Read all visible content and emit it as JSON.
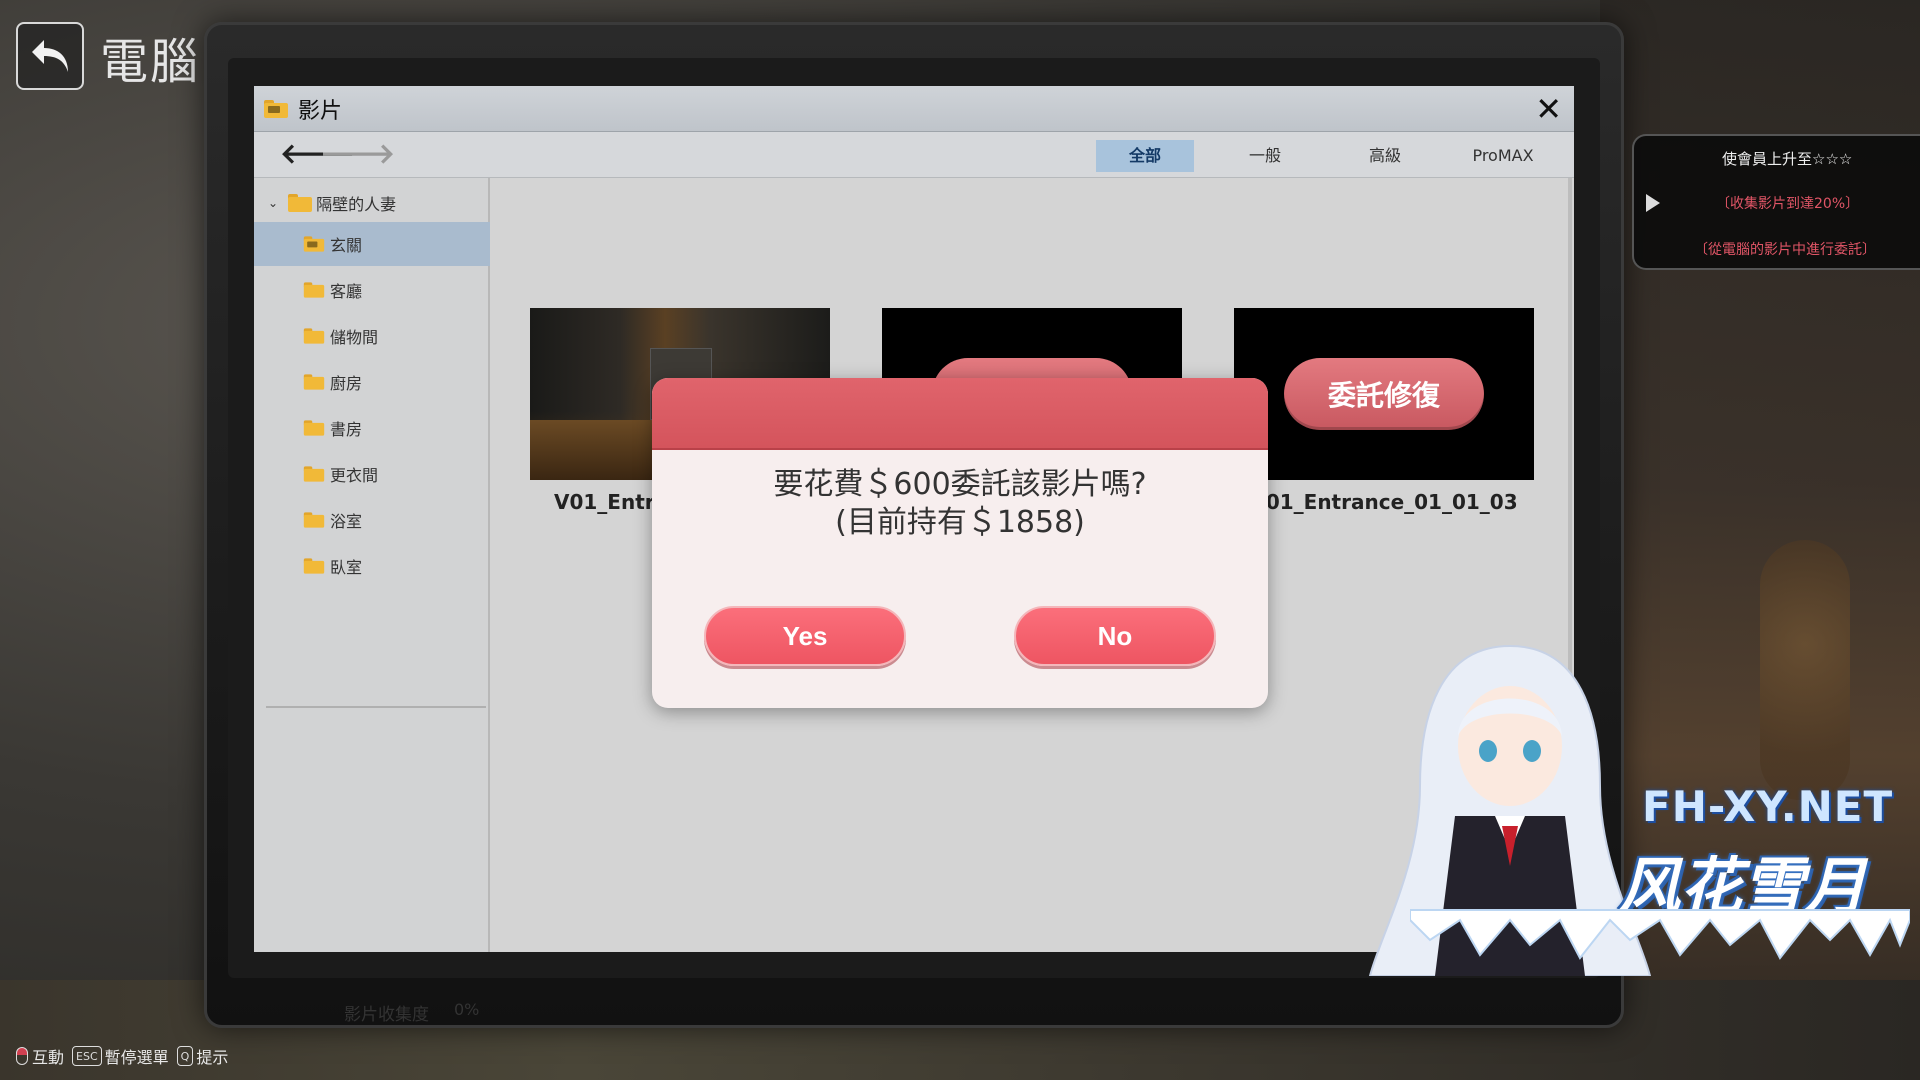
{
  "screen": {
    "title": "電腦"
  },
  "window": {
    "title": "影片",
    "filters": [
      "全部",
      "一般",
      "高級",
      "ProMAX"
    ],
    "active_filter": "全部"
  },
  "sidebar": {
    "root": "隔壁的人妻",
    "items": [
      {
        "label": "玄關",
        "selected": true
      },
      {
        "label": "客廳"
      },
      {
        "label": "儲物間"
      },
      {
        "label": "廚房"
      },
      {
        "label": "書房"
      },
      {
        "label": "更衣間"
      },
      {
        "label": "浴室"
      },
      {
        "label": "臥室"
      }
    ],
    "collection_label": "影片收集度",
    "collection_value": "0%"
  },
  "videos": [
    {
      "name": "V01_Entr",
      "state": "unlocked"
    },
    {
      "name": "",
      "state": "locked",
      "action": "委託修復"
    },
    {
      "name": "V01_Entrance_01_01_03",
      "state": "locked",
      "action": "委託修復"
    }
  ],
  "dialog": {
    "line1": "要花費＄600委託該影片嗎?",
    "line2": "(目前持有＄1858)",
    "yes": "Yes",
    "no": "No"
  },
  "task_panel": {
    "title": "使會員上升至☆☆☆",
    "line1": "〔收集影片到達20%〕",
    "line2": "〔從電腦的影片中進行委託〕"
  },
  "watermark": {
    "site": "FH-XY.NET",
    "name": "风花雪月"
  },
  "hints": {
    "interact": "互動",
    "esc_key": "ESC",
    "pause": "暫停選單",
    "q_key": "Q",
    "hint": "提示"
  },
  "colors": {
    "accent": "#ee5562",
    "dialog_header": "#d4545c",
    "active_tab": "#a8c3dc",
    "task_text": "#e05566"
  }
}
